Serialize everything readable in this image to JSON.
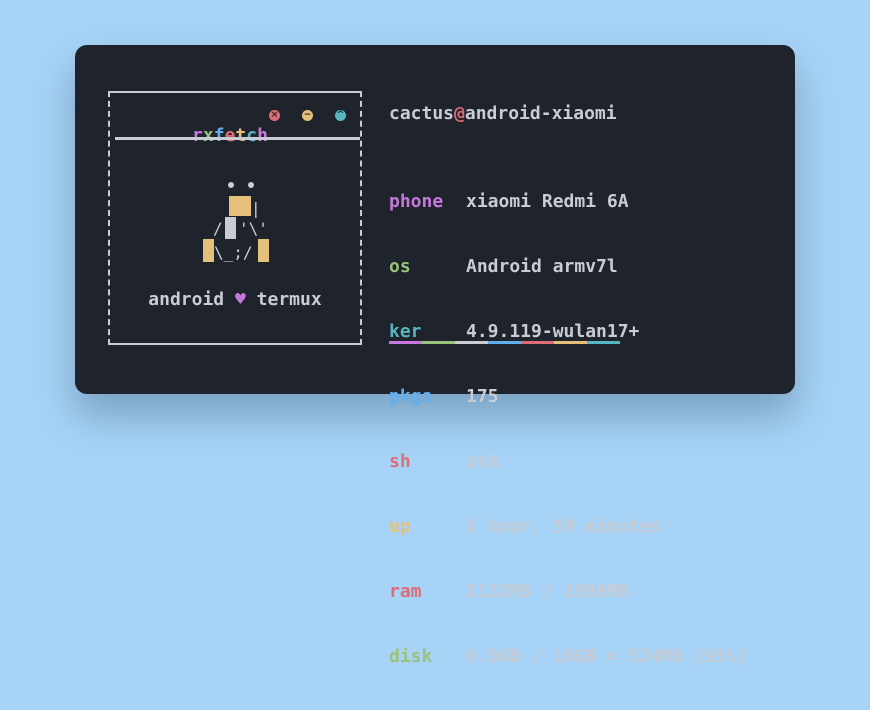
{
  "brand": {
    "letters": [
      "r",
      "x",
      "f",
      "e",
      "t",
      "c",
      "h"
    ]
  },
  "window_buttons": [
    {
      "name": "close",
      "glyph": "×",
      "color": "#e06c75"
    },
    {
      "name": "minimize",
      "glyph": "−",
      "color": "#e5c07b"
    },
    {
      "name": "maximize",
      "glyph": "^",
      "color": "#56b6c2"
    }
  ],
  "caption": {
    "left": "android",
    "heart": "♥",
    "right": "termux"
  },
  "user": {
    "name": "cactus",
    "at": "@",
    "host": "android-xiaomi"
  },
  "info": [
    {
      "key": "phone",
      "value": "xiaomi Redmi 6A",
      "color": "#c678dd"
    },
    {
      "key": "os",
      "value": "Android armv7l",
      "color": "#98c379"
    },
    {
      "key": "ker",
      "value": "4.9.119-wulan17+",
      "color": "#56b6c2"
    },
    {
      "key": "pkgs",
      "value": "175",
      "color": "#61afef"
    },
    {
      "key": "sh",
      "value": "zsh",
      "color": "#e06c75"
    },
    {
      "key": "up",
      "value": "1 hour, 59 minutes",
      "color": "#e5c07b"
    },
    {
      "key": "ram",
      "value": "1132MB / 1899MB",
      "color": "#e06c75"
    },
    {
      "key": "disk",
      "value": "9.0GB / 10GB = 524MB (95%)",
      "color": "#98c379"
    }
  ],
  "palette": [
    "#c678dd",
    "#98c379",
    "#c8ccd4",
    "#61afef",
    "#e06c75",
    "#e5c07b",
    "#56b6c2"
  ],
  "colors": {
    "background": "#a6d3f6",
    "window": "#1f232b",
    "text": "#c8ccd4"
  }
}
